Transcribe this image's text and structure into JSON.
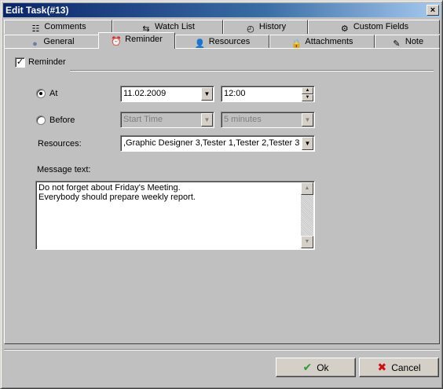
{
  "window": {
    "title": "Edit Task(#13)",
    "close_glyph": "×"
  },
  "tabs_row1": [
    {
      "label": "Comments",
      "icon": "comments-icon",
      "glyph": "☷"
    },
    {
      "label": "Watch List",
      "icon": "watch-list-icon",
      "glyph": "⇆"
    },
    {
      "label": "History",
      "icon": "history-icon",
      "glyph": "◴"
    },
    {
      "label": "Custom Fields",
      "icon": "custom-fields-icon",
      "glyph": "⚙"
    }
  ],
  "tabs_row2": [
    {
      "label": "General",
      "icon": "general-icon",
      "glyph": "●"
    },
    {
      "label": "Reminder",
      "icon": "reminder-icon",
      "glyph": "⏰",
      "active": true
    },
    {
      "label": "Resources",
      "icon": "resources-icon",
      "glyph": "👤"
    },
    {
      "label": "Attachments",
      "icon": "attachments-icon",
      "glyph": "🔒"
    },
    {
      "label": "Note",
      "icon": "note-icon",
      "glyph": "✎"
    }
  ],
  "reminder": {
    "checkbox_label": "Reminder",
    "checked": true,
    "check_glyph": "✓",
    "at_label": "At",
    "date_value": "11.02.2009",
    "time_value": "12:00",
    "before_label": "Before",
    "before_from_value": "Start Time",
    "before_amount_value": "5 minutes",
    "resources_label": "Resources:",
    "resources_value": ",Graphic Designer 3,Tester 1,Tester 2,Tester 3",
    "message_label": "Message text:",
    "message_lines": [
      "Do not forget about Friday's Meeting.",
      "Everybody should prepare weekly report."
    ]
  },
  "glyphs": {
    "dropdown": "▼",
    "spin_up": "▲",
    "spin_down": "▼",
    "scroll_up": "▲",
    "scroll_down": "▼"
  },
  "buttons": {
    "ok_label": "Ok",
    "ok_glyph": "✔",
    "ok_color": "#2e9e2e",
    "cancel_label": "Cancel",
    "cancel_glyph": "✖",
    "cancel_color": "#d01010"
  }
}
